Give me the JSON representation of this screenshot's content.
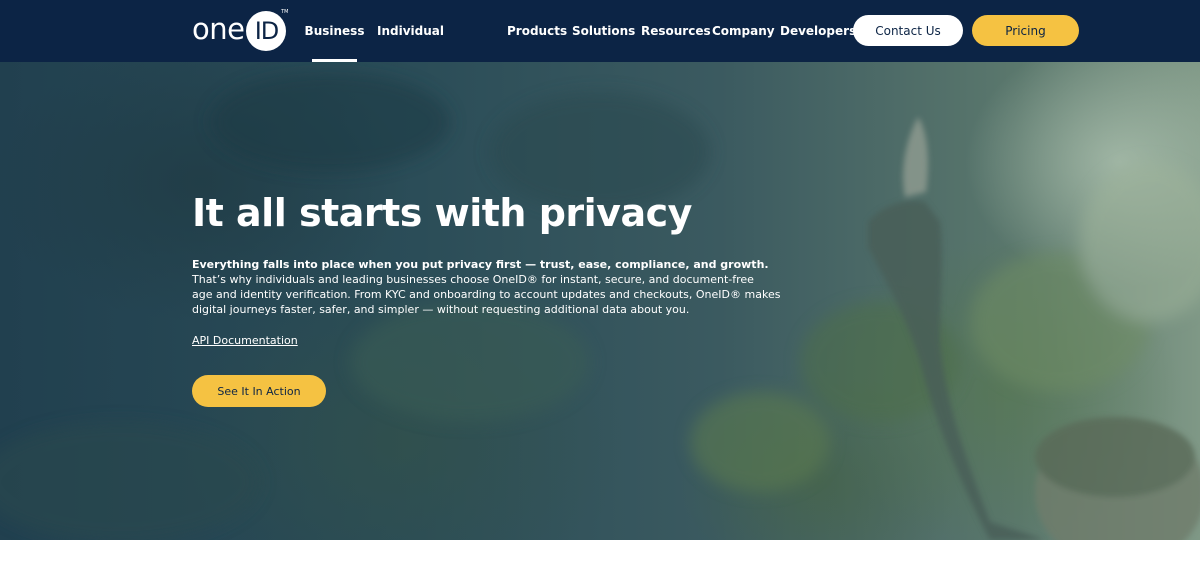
{
  "brand": {
    "logo_word": "one",
    "logo_mark": "ID",
    "logo_tm": "TM"
  },
  "header": {
    "tabs": [
      {
        "label": "Business",
        "active": true
      },
      {
        "label": "Individual",
        "active": false
      }
    ],
    "nav": [
      {
        "label": "Products"
      },
      {
        "label": "Solutions"
      },
      {
        "label": "Resources"
      },
      {
        "label": "Company"
      },
      {
        "label": "Developers"
      }
    ],
    "contact_label": "Contact Us",
    "pricing_label": "Pricing"
  },
  "hero": {
    "title": "It all starts with privacy",
    "lead": "Everything falls into place when you put privacy first — trust, ease, compliance, and growth.",
    "body_lines": [
      "That’s why individuals and leading businesses choose OneID® for instant, secure, and document-free",
      "age and identity verification. From KYC and onboarding to account updates and checkouts, OneID® makes",
      "digital journeys faster, safer, and simpler — without requesting additional data about you."
    ],
    "api_link": "API Documentation",
    "cta_label": "See It In Action"
  },
  "colors": {
    "header_bg": "#0c2445",
    "accent_yellow": "#f5c242",
    "text_white": "#ffffff"
  }
}
